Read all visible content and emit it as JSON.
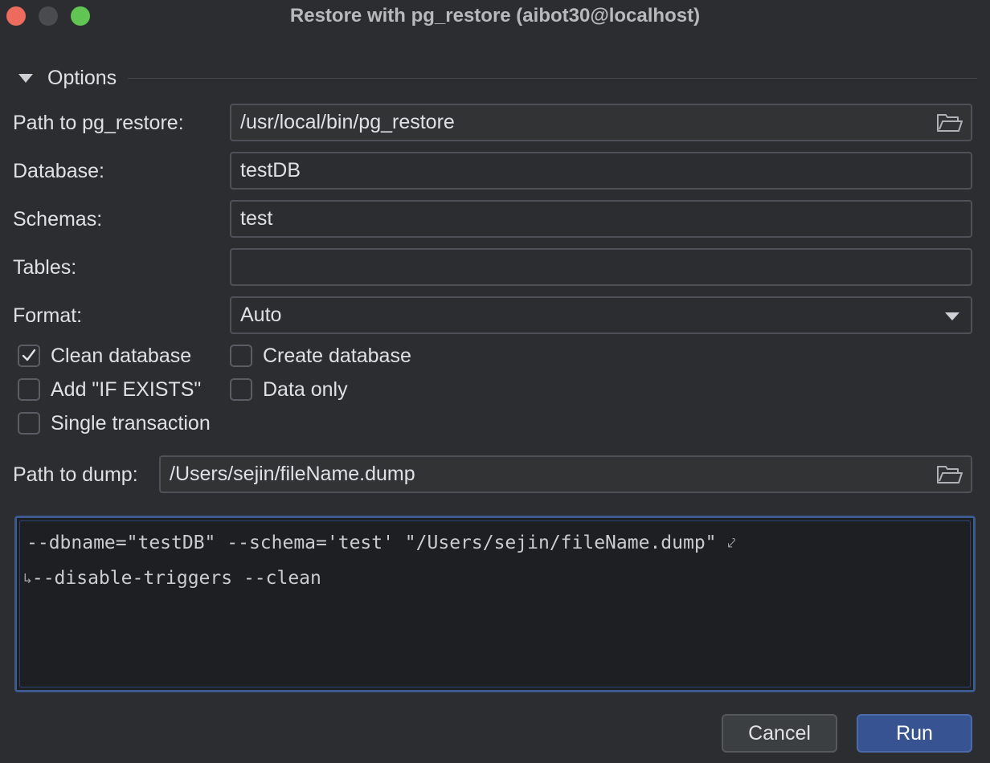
{
  "window": {
    "title": "Restore with pg_restore (aibot30@localhost)"
  },
  "options": {
    "header": "Options",
    "path_to_pg_restore": {
      "label": "Path to pg_restore:",
      "value": "/usr/local/bin/pg_restore"
    },
    "database": {
      "label": "Database:",
      "value": "testDB"
    },
    "schemas": {
      "label": "Schemas:",
      "value": "test"
    },
    "tables": {
      "label": "Tables:",
      "value": ""
    },
    "format": {
      "label": "Format:",
      "value": "Auto"
    },
    "checkboxes": {
      "clean_database": {
        "label": "Clean database",
        "checked": true
      },
      "create_database": {
        "label": "Create database",
        "checked": false
      },
      "add_if_exists": {
        "label": "Add \"IF EXISTS\"",
        "checked": false
      },
      "data_only": {
        "label": "Data only",
        "checked": false
      },
      "single_transaction": {
        "label": "Single transaction",
        "checked": false
      }
    },
    "path_to_dump": {
      "label": "Path to dump:",
      "value": "/Users/sejin/fileName.dump"
    }
  },
  "command": {
    "line1": "--dbname=\"testDB\" --schema='test' \"/Users/sejin/fileName.dump\" ",
    "line2": "--disable-triggers --clean"
  },
  "buttons": {
    "cancel": "Cancel",
    "run": "Run"
  },
  "colors": {
    "background": "#2b2d30",
    "accent": "#375391",
    "close": "#ec6a5e",
    "maximize": "#61c554"
  }
}
